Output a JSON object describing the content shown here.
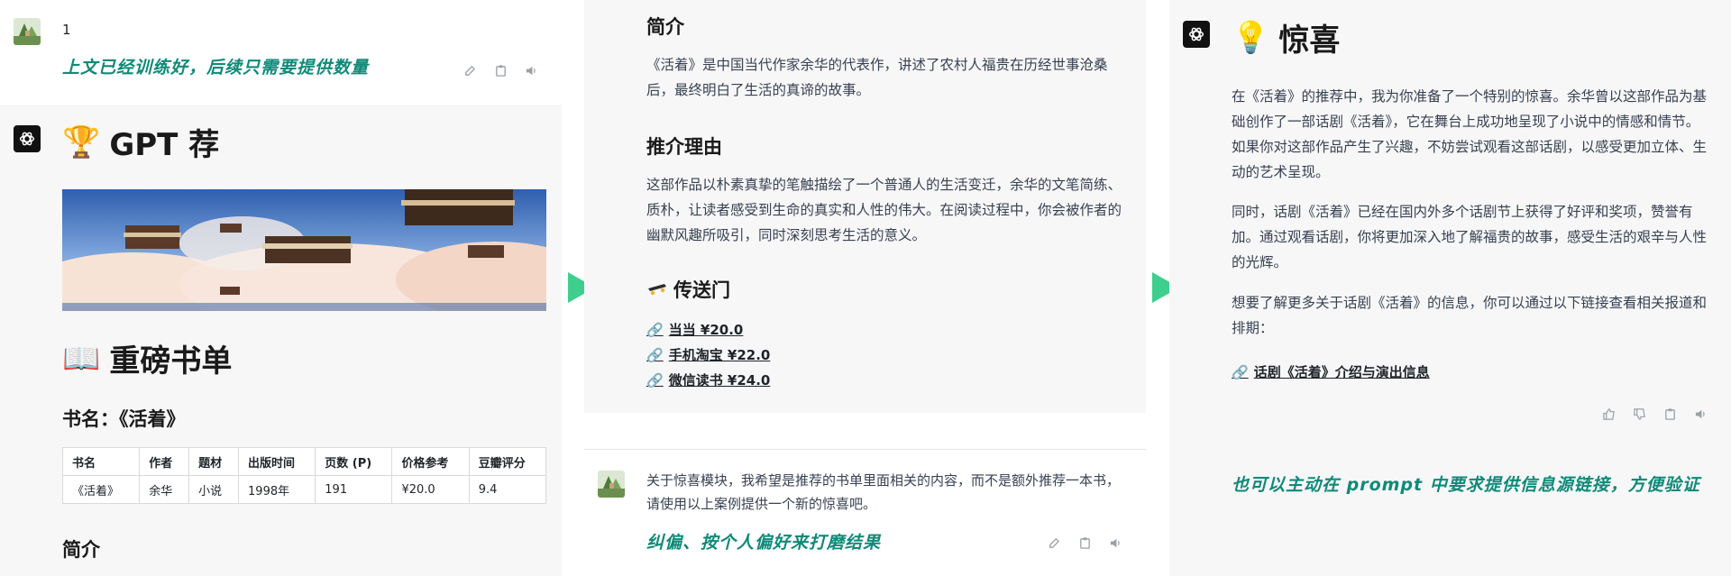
{
  "colors": {
    "accent_green": "#0f8a78",
    "arrow": "#3ecf8e"
  },
  "panel1": {
    "user_message": "1",
    "annotation": "上文已经训练好，后续只需要提供数量",
    "title_emoji": "🏆",
    "title": "GPT 荐",
    "section_emoji": "📖",
    "section_title": "重磅书单",
    "book_heading": "书名：《活着》",
    "table": {
      "headers": [
        "书名",
        "作者",
        "题材",
        "出版时间",
        "页数 (P)",
        "价格参考",
        "豆瓣评分"
      ],
      "row": [
        "《活着》",
        "余华",
        "小说",
        "1998年",
        "191",
        "¥20.0",
        "9.4"
      ]
    },
    "intro_heading": "简介"
  },
  "panel2": {
    "intro_heading": "简介",
    "intro_text": "《活着》是中国当代作家余华的代表作，讲述了农村人福贵在历经世事沧桑后，最终明白了生活的真谛的故事。",
    "reason_heading": "推介理由",
    "reason_text": "这部作品以朴素真挚的笔触描绘了一个普通人的生活变迁，余华的文笔简练、质朴，让读者感受到生命的真实和人性的伟大。在阅读过程中，你会被作者的幽默风趣所吸引，同时深刻思考生活的意义。",
    "portal_heading": "传送门",
    "links": [
      "当当 ¥20.0",
      "手机淘宝 ¥22.0",
      "微信读书 ¥24.0"
    ],
    "user_message": "关于惊喜模块，我希望是推荐的书单里面相关的内容，而不是额外推荐一本书，请使用以上案例提供一个新的惊喜吧。",
    "annotation": "纠偏、按个人偏好来打磨结果"
  },
  "panel3": {
    "title_emoji": "💡",
    "title": "惊喜",
    "para1": "在《活着》的推荐中，我为你准备了一个特别的惊喜。余华曾以这部作品为基础创作了一部话剧《活着》，它在舞台上成功地呈现了小说中的情感和情节。如果你对这部作品产生了兴趣，不妨尝试观看这部话剧，以感受更加立体、生动的艺术呈现。",
    "para2": "同时，话剧《活着》已经在国内外多个话剧节上获得了好评和奖项，赞誉有加。通过观看话剧，你将更加深入地了解福贵的故事，感受生活的艰辛与人性的光辉。",
    "para3": "想要了解更多关于话剧《活着》的信息，你可以通过以下链接查看相关报道和排期：",
    "link": "话剧《活着》介绍与演出信息",
    "annotation": "也可以主动在 prompt 中要求提供信息源链接，方便验证"
  }
}
